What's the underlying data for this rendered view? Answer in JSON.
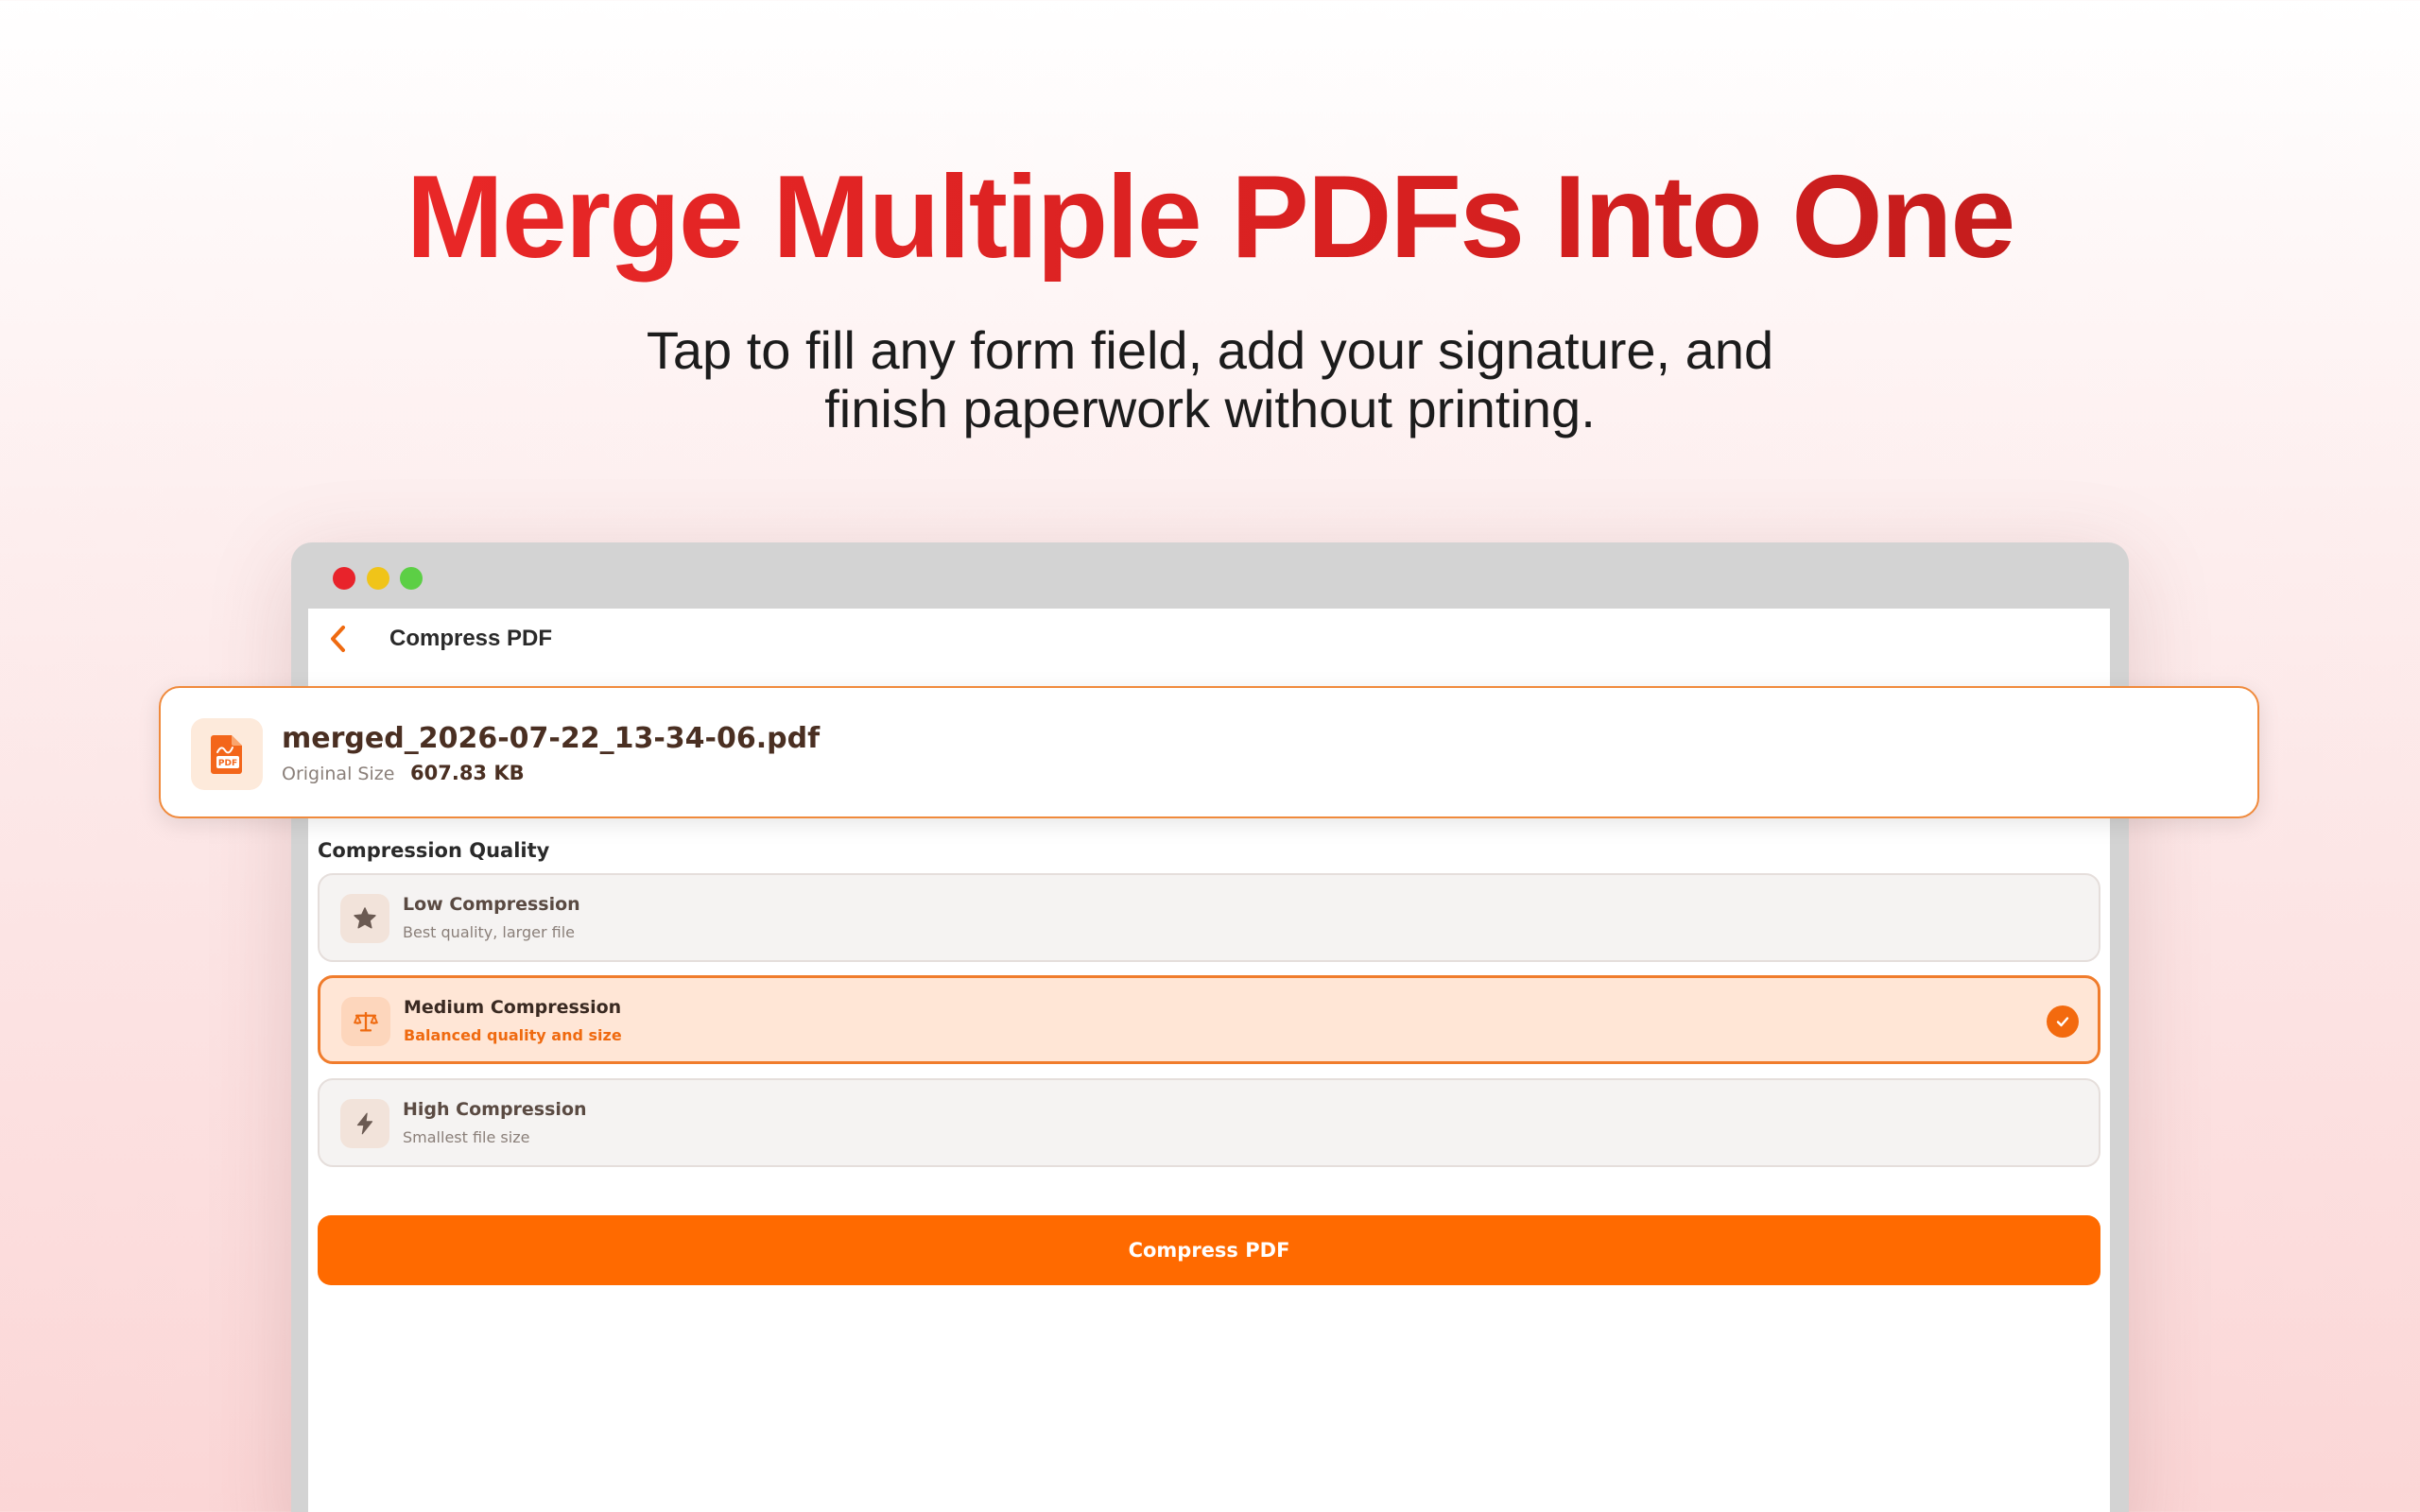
{
  "hero": {
    "title": "Merge Multiple PDFs Into One",
    "subtitle_line1": "Tap to fill any form field, add your signature, and",
    "subtitle_line2": "finish paperwork without printing."
  },
  "window": {
    "traffic_lights": {
      "close": "#e8232b",
      "minimize": "#f0c419",
      "zoom": "#5ccf45"
    }
  },
  "app": {
    "back_icon": "chevron-left-icon",
    "title": "Compress PDF"
  },
  "file": {
    "icon": "pdf-file-icon",
    "name": "merged_2026-07-22_13-34-06.pdf",
    "size_label": "Original Size",
    "size_value": "607.83 KB"
  },
  "compression": {
    "label": "Compression Quality",
    "options": [
      {
        "icon": "star-icon",
        "title": "Low Compression",
        "subtitle": "Best quality, larger file",
        "selected": false
      },
      {
        "icon": "balance-scale-icon",
        "title": "Medium Compression",
        "subtitle": "Balanced quality and size",
        "selected": true
      },
      {
        "icon": "lightning-bolt-icon",
        "title": "High Compression",
        "subtitle": "Smallest file size",
        "selected": false
      }
    ]
  },
  "action": {
    "button_label": "Compress PDF"
  },
  "colors": {
    "accent": "#ff6a00",
    "title_red": "#e52222",
    "selected_bg": "#ffe6d6"
  }
}
